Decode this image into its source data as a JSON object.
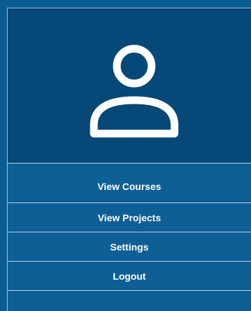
{
  "profile": {
    "avatar_icon": "user-icon"
  },
  "menu": {
    "items": [
      {
        "label": "View Courses"
      },
      {
        "label": "View Projects"
      },
      {
        "label": "Settings"
      },
      {
        "label": "Logout"
      }
    ]
  },
  "colors": {
    "profile_background": "#064877",
    "menu_background": "#0e5f96",
    "divider": "#b8d2e6",
    "text": "#ffffff"
  }
}
